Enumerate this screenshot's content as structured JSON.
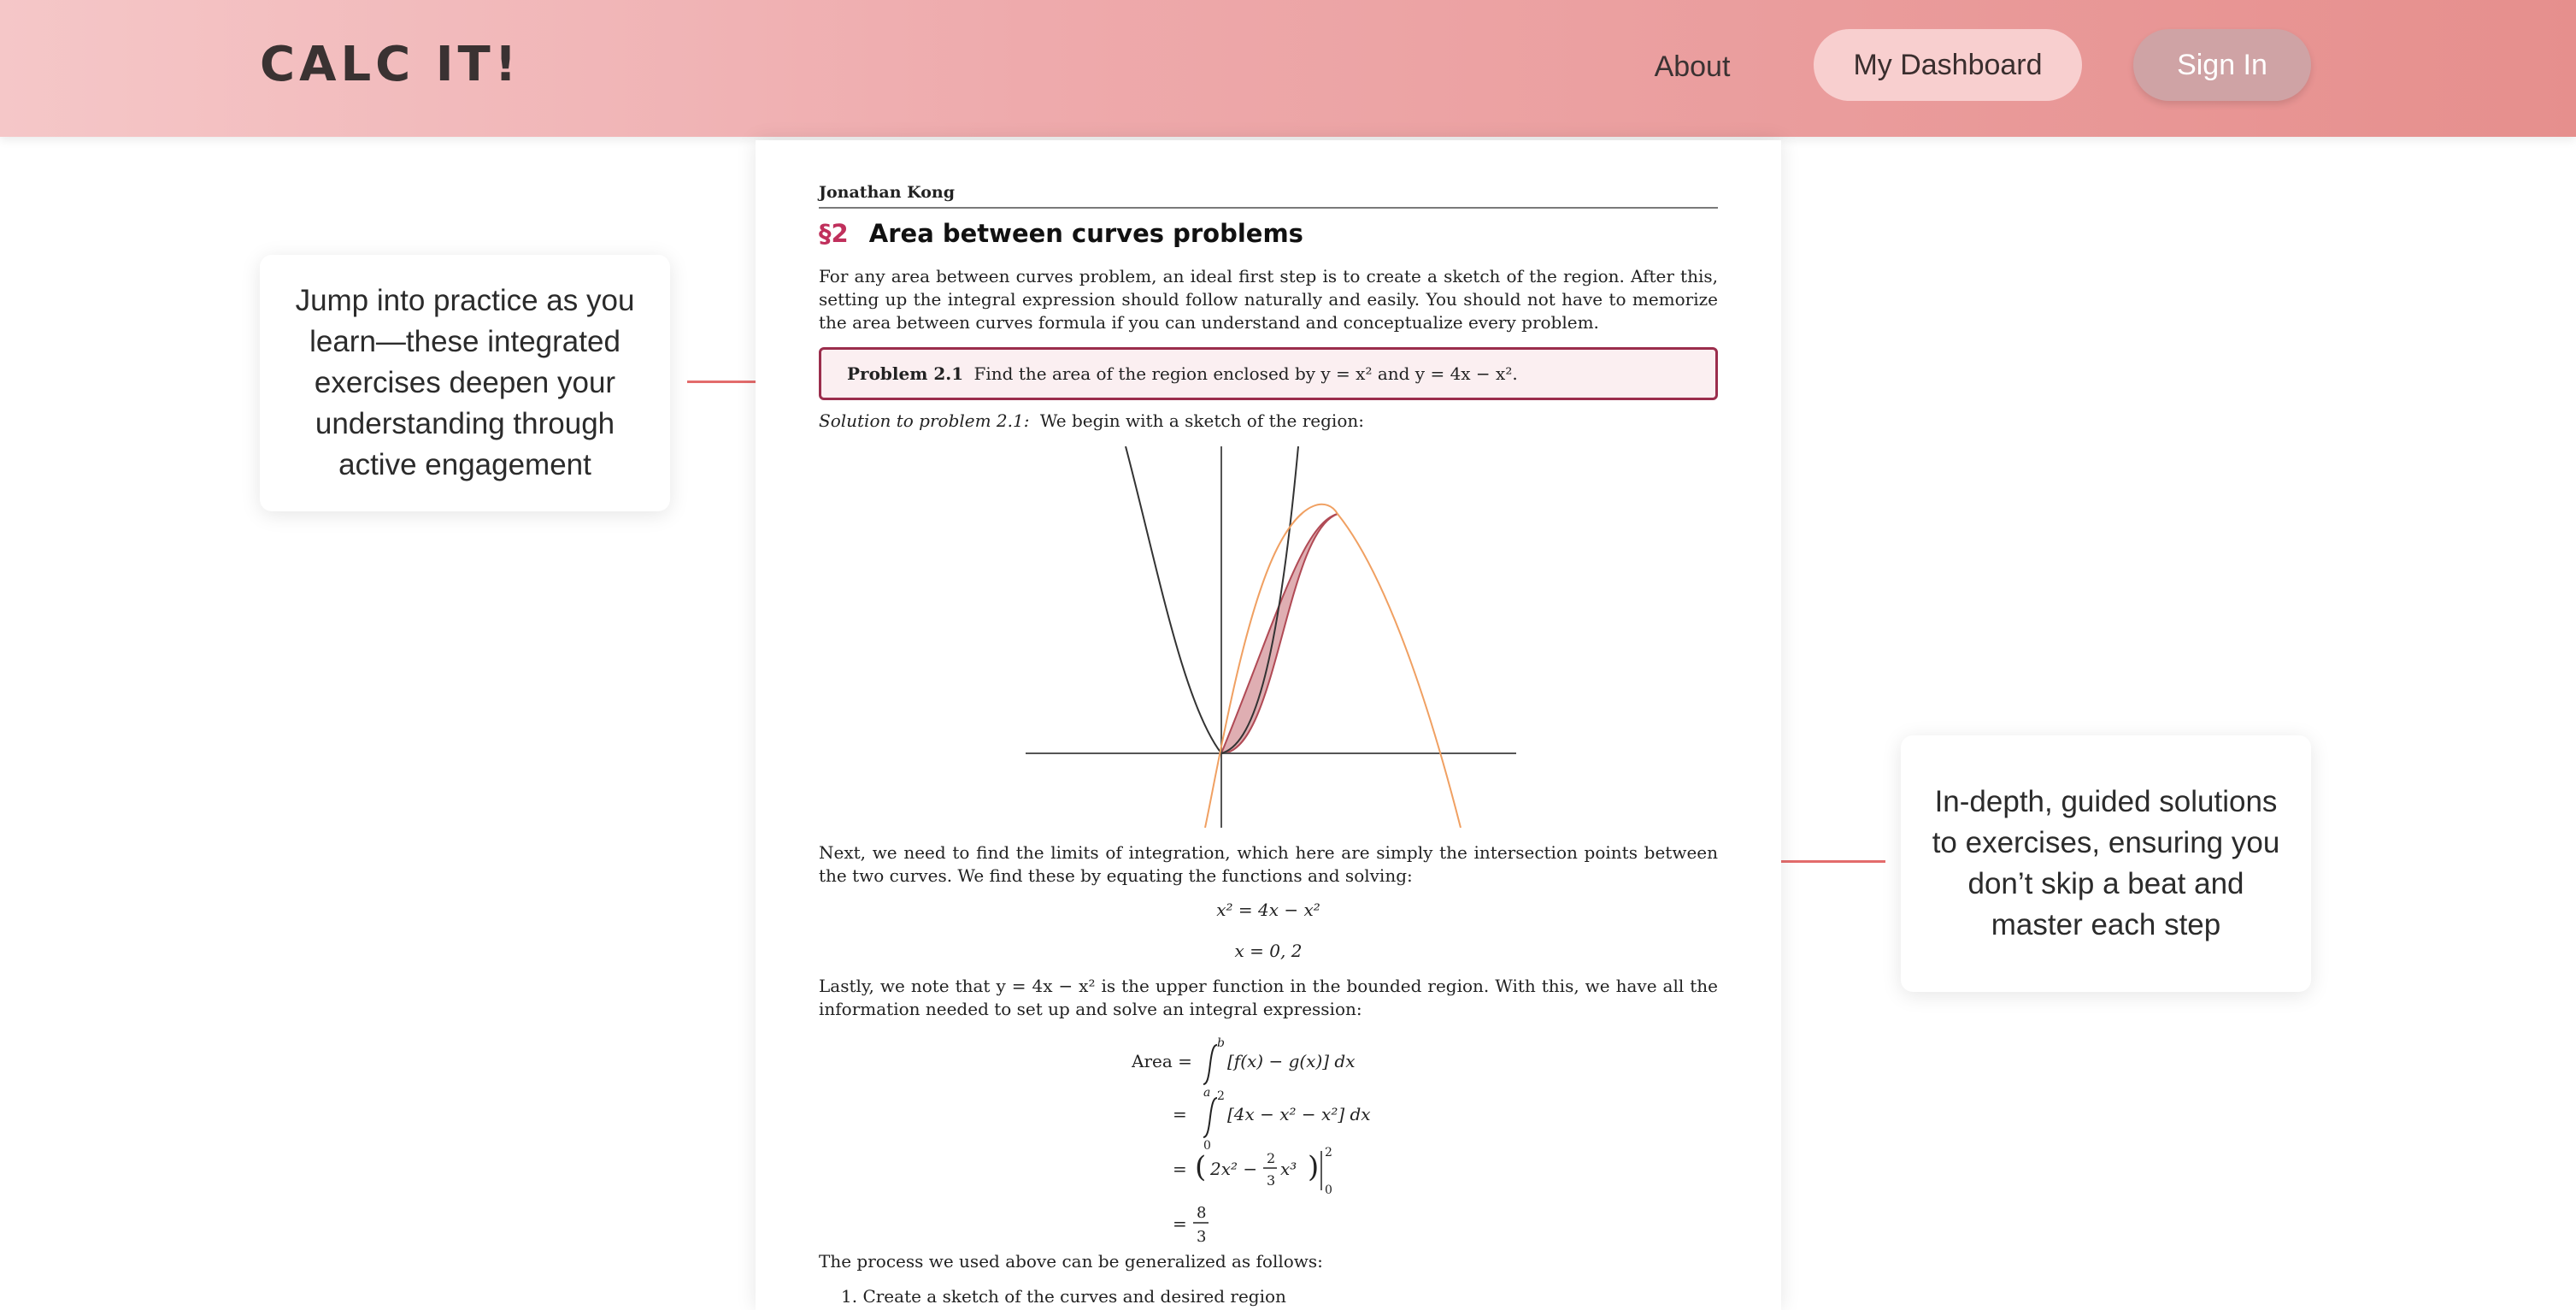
{
  "header": {
    "logo": "CALC IT!",
    "nav": {
      "about": "About",
      "dashboard": "My Dashboard",
      "sign_in": "Sign In"
    }
  },
  "callouts": {
    "left": "Jump into practice as you learn—these integrated exercises deepen your understanding through active engagement",
    "right": "In-depth, guided solutions to exercises, ensuring you don’t skip a beat and master each step"
  },
  "document": {
    "author": "Jonathan Kong",
    "section_number": "§2",
    "section_title": "Area between curves problems",
    "intro": "For any area between curves problem, an ideal first step is to create a sketch of the region. After this, setting up the integral expression should follow naturally and easily. You should not have to memorize the area between curves formula if you can understand and conceptualize every problem.",
    "problem_label": "Problem 2.1",
    "problem_text": "Find the area of the region enclosed by y = x² and y = 4x − x².",
    "solution_label": "Solution to problem 2.1:",
    "solution_text": "We begin with a sketch of the region:",
    "limits_text": "Next, we need to find the limits of integration, which here are simply the intersection points between the two curves. We find these by equating the functions and solving:",
    "equation_1": "x² = 4x − x²",
    "equation_2": "x = 0, 2",
    "upper_text": "Lastly, we note that y = 4x − x² is the upper function in the bounded region. With this, we have all the information needed to set up and solve an integral expression:",
    "area_label": "Area =",
    "area_line_1": "[f(x) − g(x)] dx",
    "area_line_2": "[4x − x² − x²] dx",
    "area_line_3_a": "2x² −",
    "area_line_3_b": "x³",
    "area_final_num": "8",
    "area_final_den": "3",
    "frac_num": "2",
    "frac_den": "3",
    "limit_a": "a",
    "limit_b": "b",
    "limit_0": "0",
    "limit_2": "2",
    "general_text": "The process we used above can be generalized as follows:",
    "step_1": "1. Create a sketch of the curves and desired region"
  },
  "colors": {
    "accent": "#c0305c",
    "box_border": "#9b2d4c",
    "connector": "#e36c6c",
    "shaded_region": "#d9a0a5",
    "parabola_up": "#333333",
    "parabola_down": "#f0a062"
  }
}
